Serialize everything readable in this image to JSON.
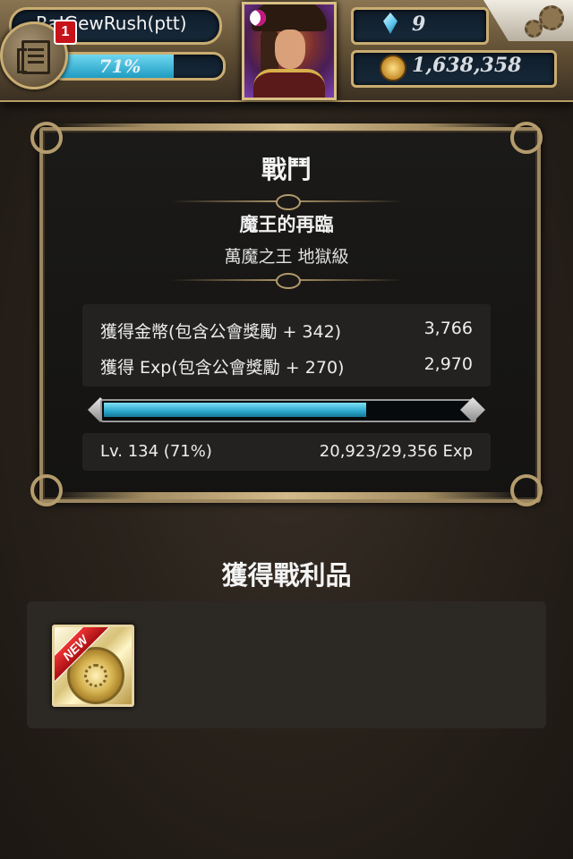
{
  "header": {
    "player_name": "RaIGewRush(ptt)",
    "notification_count": "1",
    "exp_percent_label": "71%",
    "exp_fraction": 0.71,
    "gems": "9",
    "coins": "1,638,358"
  },
  "battle": {
    "title": "戰鬥",
    "stage_name": "魔王的再臨",
    "stage_difficulty": "萬魔之王 地獄級",
    "rewards": [
      {
        "label": "獲得金幣(包含公會獎勵 + 342)",
        "value": "3,766"
      },
      {
        "label": "獲得 Exp(包含公會獎勵 + 270)",
        "value": "2,970"
      }
    ],
    "exp_bar_fraction": 0.71,
    "level_text": "Lv. 134 (71%)",
    "exp_text": "20,923/29,356 Exp"
  },
  "loot": {
    "title": "獲得戰利品",
    "items": [
      {
        "badge": "NEW",
        "icon": "gold-coin-card-icon"
      }
    ]
  },
  "colors": {
    "accent_cyan": "#2aa6cc",
    "frame_gold": "#c9ad72",
    "badge_red": "#c8121a"
  }
}
